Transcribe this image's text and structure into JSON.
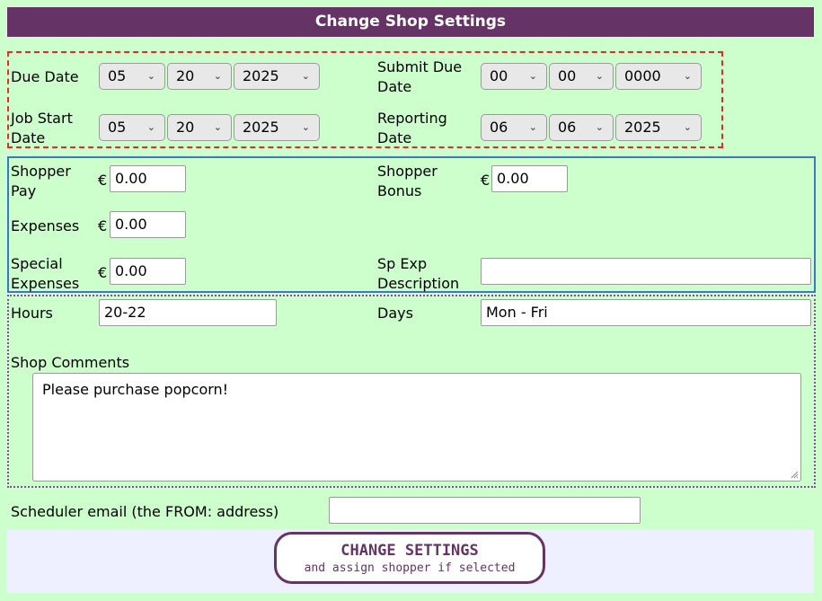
{
  "title": "Change Shop Settings",
  "dates": {
    "due_date": {
      "label": "Due Date",
      "month": "05",
      "day": "20",
      "year": "2025"
    },
    "submit_due_date": {
      "label_line1": "Submit Due",
      "label_line2": "Date",
      "month": "00",
      "day": "00",
      "year": "0000"
    },
    "job_start_date": {
      "label_line1": "Job Start",
      "label_line2": "Date",
      "month": "05",
      "day": "20",
      "year": "2025"
    },
    "reporting_date": {
      "label_line1": "Reporting",
      "label_line2": "Date",
      "month": "06",
      "day": "06",
      "year": "2025"
    }
  },
  "money": {
    "currency_symbol": "€",
    "shopper_pay": {
      "label_line1": "Shopper",
      "label_line2": "Pay",
      "value": "0.00"
    },
    "shopper_bonus": {
      "label_line1": "Shopper",
      "label_line2": "Bonus",
      "value": "0.00"
    },
    "expenses": {
      "label": "Expenses",
      "value": "0.00"
    },
    "special_expenses": {
      "label_line1": "Special",
      "label_line2": "Expenses",
      "value": "0.00"
    },
    "sp_exp_description": {
      "label_line1": "Sp Exp",
      "label_line2": "Description",
      "value": ""
    }
  },
  "schedule": {
    "hours": {
      "label": "Hours",
      "value": "20-22"
    },
    "days": {
      "label": "Days",
      "value": "Mon - Fri"
    },
    "shop_comments": {
      "label": "Shop Comments",
      "value": "Please purchase popcorn!"
    }
  },
  "scheduler_email": {
    "label": "Scheduler email (the FROM: address)",
    "value": ""
  },
  "submit_button": {
    "line1": "CHANGE SETTINGS",
    "line2": "and assign shopper if selected"
  },
  "colors": {
    "title_bg": "#663366",
    "page_bg": "#ccffcc",
    "dates_border": "#d9302a",
    "money_border": "#3a78c2",
    "hours_border": "#8e44ad"
  }
}
